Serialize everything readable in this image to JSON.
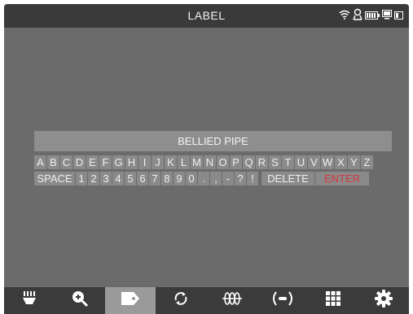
{
  "header": {
    "title": "LABEL"
  },
  "status_icons": [
    "wifi-icon",
    "gps-icon",
    "battery-icon",
    "display-icon",
    "battery-small-icon"
  ],
  "label_field": {
    "value": "BELLIED PIPE"
  },
  "keyboard": {
    "row1": [
      "A",
      "B",
      "C",
      "D",
      "E",
      "F",
      "G",
      "H",
      "I",
      "J",
      "K",
      "L",
      "M",
      "N",
      "O",
      "P",
      "Q",
      "R",
      "S",
      "T",
      "U",
      "V",
      "W",
      "X",
      "Y",
      "Z"
    ],
    "row2_space": "SPACE",
    "row2_chars": [
      "1",
      "2",
      "3",
      "4",
      "5",
      "6",
      "7",
      "8",
      "9",
      "0",
      ".",
      ",",
      "-",
      "?",
      "!"
    ],
    "delete_label": "DELETE",
    "enter_label": "ENTER"
  },
  "dock": {
    "items": [
      "gauge-icon",
      "zoom-in-icon",
      "label-tag-icon",
      "rotate-icon",
      "pipe-icon",
      "signal-icon",
      "grid-icon",
      "settings-icon"
    ],
    "active": "label-tag-icon"
  },
  "colors": {
    "accent_enter": "#d8353f",
    "background": "#6b6b6b",
    "bar": "#3a3a3a"
  }
}
